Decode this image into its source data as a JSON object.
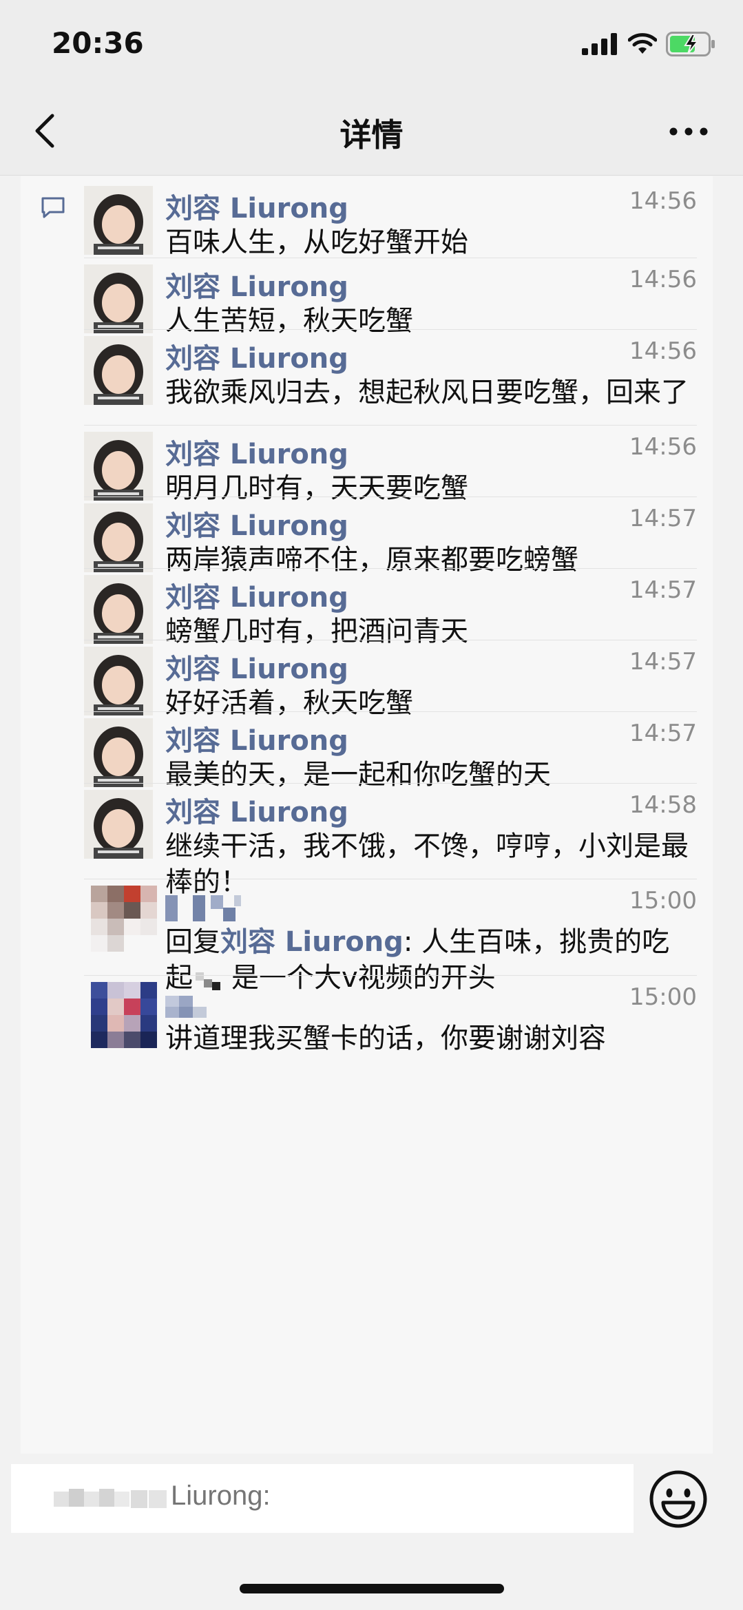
{
  "status_bar": {
    "time": "20:36"
  },
  "nav": {
    "title": "详情"
  },
  "comments": [
    {
      "name": "刘容 Liurong",
      "time": "14:56",
      "text": "百味人生，从吃好蟹开始"
    },
    {
      "name": "刘容 Liurong",
      "time": "14:56",
      "text": "人生苦短，秋天吃蟹"
    },
    {
      "name": "刘容 Liurong",
      "time": "14:56",
      "text": "我欲乘风归去，想起秋风日要吃蟹，回来了"
    },
    {
      "name": "刘容 Liurong",
      "time": "14:56",
      "text": "明月几时有，天天要吃蟹"
    },
    {
      "name": "刘容 Liurong",
      "time": "14:57",
      "text": "两岸猿声啼不住，原来都要吃螃蟹"
    },
    {
      "name": "刘容 Liurong",
      "time": "14:57",
      "text": "螃蟹几时有，把酒问青天"
    },
    {
      "name": "刘容 Liurong",
      "time": "14:57",
      "text": "好好活着，秋天吃蟹"
    },
    {
      "name": "刘容 Liurong",
      "time": "14:57",
      "text": "最美的天，是一起和你吃蟹的天"
    },
    {
      "name": "刘容 Liurong",
      "time": "14:58",
      "text": "继续干活，我不饿，不馋，哼哼，小刘是最棒的！"
    }
  ],
  "reply_comment": {
    "time": "15:00",
    "prefix": "回复",
    "reply_to": "刘容 Liurong",
    "text_part1": ": 人生百味，挑贵的吃",
    "text_part2": "起",
    "text_part3": "是一个大v视频的开头"
  },
  "last_comment": {
    "time": "15:00",
    "text": "讲道理我买蟹卡的话，你要谢谢刘容"
  },
  "input": {
    "placeholder": "Liurong:"
  },
  "icons": {
    "back": "chevron-left-icon",
    "more": "more-dots-icon",
    "comment": "comment-icon",
    "emoji": "emoji-icon"
  },
  "colors": {
    "name": "#576b95",
    "battery": "#4cd964"
  }
}
